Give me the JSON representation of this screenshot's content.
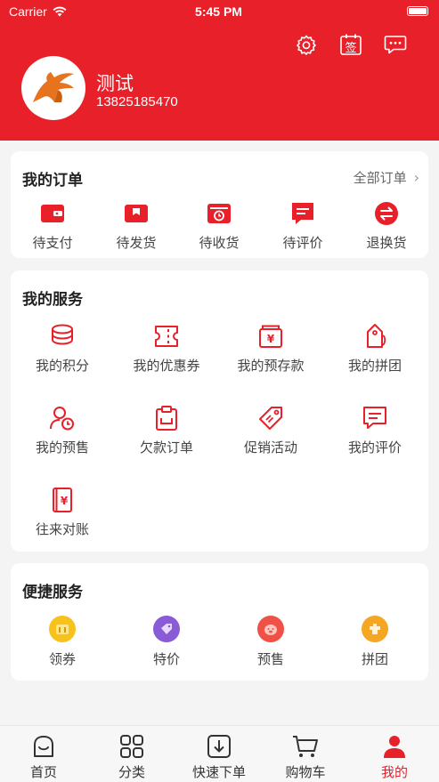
{
  "status_bar": {
    "carrier": "Carrier",
    "time": "5:45 PM"
  },
  "profile": {
    "name": "测试",
    "phone": "13825185470"
  },
  "top_icons": [
    "gear-icon",
    "calendar-sign-icon",
    "message-icon"
  ],
  "calendar_glyph": "签",
  "orders": {
    "title": "我的订单",
    "all_link": "全部订单",
    "items": [
      {
        "label": "待支付",
        "icon": "wallet-icon"
      },
      {
        "label": "待发货",
        "icon": "package-icon"
      },
      {
        "label": "待收货",
        "icon": "delivery-box-icon"
      },
      {
        "label": "待评价",
        "icon": "comment-icon"
      },
      {
        "label": "退换货",
        "icon": "exchange-icon"
      }
    ]
  },
  "services": {
    "title": "我的服务",
    "items": [
      {
        "label": "我的积分",
        "icon": "coins-icon"
      },
      {
        "label": "我的优惠券",
        "icon": "ticket-icon"
      },
      {
        "label": "我的预存款",
        "icon": "deposit-icon"
      },
      {
        "label": "我的拼团",
        "icon": "price-tag-icon"
      },
      {
        "label": "我的预售",
        "icon": "user-clock-icon"
      },
      {
        "label": "欠款订单",
        "icon": "clipboard-icon"
      },
      {
        "label": "促销活动",
        "icon": "promo-tag-icon"
      },
      {
        "label": "我的评价",
        "icon": "review-icon"
      },
      {
        "label": "往来对账",
        "icon": "ledger-icon"
      }
    ]
  },
  "quick": {
    "title": "便捷服务",
    "items": [
      {
        "label": "领券",
        "icon": "coupon-circle-icon",
        "color": "#f7c21b"
      },
      {
        "label": "特价",
        "icon": "special-price-circle-icon",
        "color": "#8a5bd6"
      },
      {
        "label": "预售",
        "icon": "presale-circle-icon",
        "color": "#ef5146"
      },
      {
        "label": "拼团",
        "icon": "group-circle-icon",
        "color": "#f5a623"
      }
    ]
  },
  "tabbar": [
    {
      "label": "首页",
      "icon": "home-icon",
      "active": false
    },
    {
      "label": "分类",
      "icon": "grid-icon",
      "active": false
    },
    {
      "label": "快速下单",
      "icon": "download-order-icon",
      "active": false
    },
    {
      "label": "购物车",
      "icon": "cart-icon",
      "active": false
    },
    {
      "label": "我的",
      "icon": "user-icon",
      "active": true
    }
  ],
  "colors": {
    "primary": "#e8202a",
    "background": "#f4f4f4",
    "card": "#ffffff"
  }
}
